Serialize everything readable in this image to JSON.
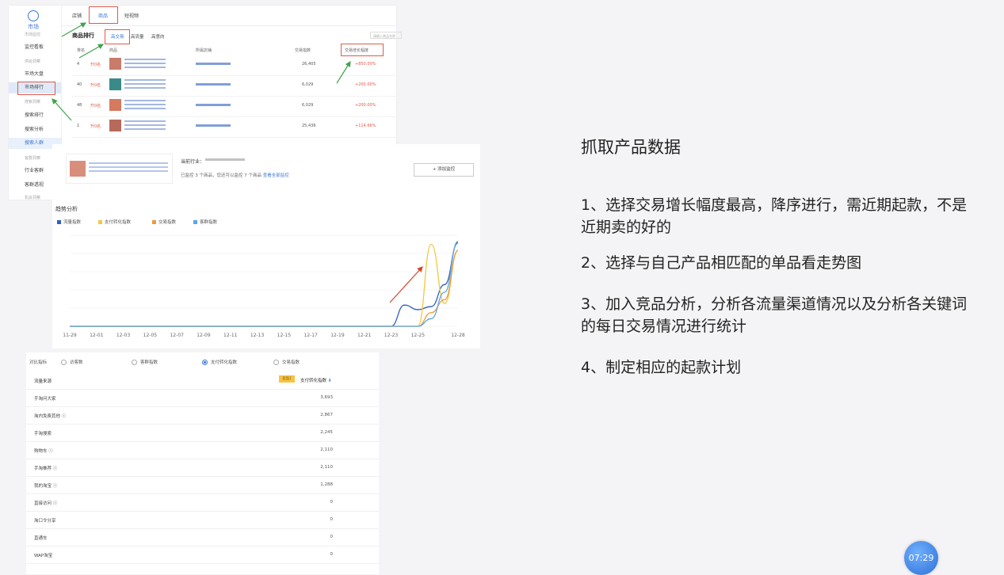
{
  "market_panel": {
    "sidebar": {
      "logo": "市场",
      "items": [
        {
          "label": "市场监控",
          "group": true
        },
        {
          "label": "监控看板"
        },
        {
          "label": "供给洞察",
          "group": true
        },
        {
          "label": "市场大盘"
        },
        {
          "label": "市场排行",
          "selected": true
        },
        {
          "label": "搜索洞察",
          "group": true
        },
        {
          "label": "搜索排行"
        },
        {
          "label": "搜索分析"
        },
        {
          "label": "搜索人群",
          "active": true
        },
        {
          "label": "客群洞察",
          "group": true
        },
        {
          "label": "行业客群"
        },
        {
          "label": "客群透视"
        },
        {
          "label": "机会洞察",
          "group": true
        }
      ]
    },
    "tabs": [
      "店铺",
      "商品",
      "短视频"
    ],
    "section_title": "商品排行",
    "subtabs": [
      "高交易",
      "高流量",
      "高意向"
    ],
    "search_placeholder": "请输入商品名称",
    "columns": [
      "排名",
      "商品",
      "所属店铺",
      "交易指数",
      "交易增长幅度"
    ],
    "rows": [
      {
        "rank": "4",
        "change": "升0名",
        "index": "26,405",
        "growth": "+850.00%"
      },
      {
        "rank": "40",
        "change": "升0名",
        "index": "6,029",
        "growth": "+200.00%"
      },
      {
        "rank": "48",
        "change": "升0名",
        "index": "6,029",
        "growth": "+200.00%"
      },
      {
        "rank": "1",
        "change": "升0名",
        "index": "25,436",
        "growth": "+114.66%"
      }
    ]
  },
  "trend_panel": {
    "industry_label": "当前行业：",
    "monitor_text": "已监控 3 个商品，您还可以监控 7 个商品",
    "monitor_link": "查看全部监控",
    "add_button": "+ 添加监控",
    "title": "趋势分析",
    "legend": [
      {
        "name": "流量指数",
        "color": "#2f5fc4"
      },
      {
        "name": "支付转化指数",
        "color": "#f2c744"
      },
      {
        "name": "交易指数",
        "color": "#ec9a3a"
      },
      {
        "name": "客群指数",
        "color": "#5aa6e8"
      }
    ],
    "chart_data": {
      "type": "line",
      "x": [
        "11-29",
        "11-30",
        "12-01",
        "12-02",
        "12-03",
        "12-04",
        "12-05",
        "12-06",
        "12-07",
        "12-08",
        "12-09",
        "12-10",
        "12-11",
        "12-12",
        "12-13",
        "12-14",
        "12-15",
        "12-16",
        "12-17",
        "12-18",
        "12-19",
        "12-20",
        "12-21",
        "12-22",
        "12-23",
        "12-24",
        "12-25",
        "12-26",
        "12-27",
        "12-28"
      ],
      "x_tick_labels": [
        "11-29",
        "12-01",
        "12-03",
        "12-05",
        "12-07",
        "12-09",
        "12-11",
        "12-13",
        "12-15",
        "12-17",
        "12-19",
        "12-21",
        "12-23",
        "12-25",
        "12-28"
      ],
      "series": [
        {
          "name": "流量指数",
          "values": [
            0,
            0,
            0,
            0,
            0,
            0,
            0,
            0,
            0,
            0,
            0,
            0,
            0,
            0,
            0,
            0,
            0,
            0,
            0,
            0,
            0,
            0,
            0,
            0,
            0,
            28,
            22,
            26,
            55,
            110
          ]
        },
        {
          "name": "支付转化指数",
          "values": [
            0,
            0,
            0,
            0,
            0,
            0,
            0,
            0,
            0,
            0,
            0,
            0,
            0,
            0,
            0,
            0,
            0,
            0,
            0,
            0,
            0,
            0,
            0,
            0,
            0,
            0,
            0,
            108,
            30,
            100
          ]
        },
        {
          "name": "交易指数",
          "values": [
            0,
            0,
            0,
            0,
            0,
            0,
            0,
            0,
            0,
            0,
            0,
            0,
            0,
            0,
            0,
            0,
            0,
            0,
            0,
            0,
            0,
            0,
            0,
            0,
            0,
            0,
            0,
            18,
            35,
            100
          ]
        },
        {
          "name": "客群指数",
          "values": [
            0,
            0,
            0,
            0,
            0,
            0,
            0,
            0,
            0,
            0,
            0,
            0,
            0,
            0,
            0,
            0,
            0,
            0,
            0,
            0,
            0,
            0,
            0,
            0,
            0,
            0,
            0,
            10,
            45,
            112
          ]
        }
      ],
      "ylim": [
        0,
        120
      ],
      "grid": true,
      "legend": "top-left"
    }
  },
  "source_panel": {
    "compare_label": "对比指标",
    "radios": [
      {
        "label": "访客数",
        "checked": false
      },
      {
        "label": "客群指数",
        "checked": false
      },
      {
        "label": "支付转化指数",
        "checked": true
      },
      {
        "label": "交易指数",
        "checked": false
      }
    ],
    "header_label": "流量来源",
    "header_badge": "竞品1",
    "header_column": "支付转化指数",
    "rows": [
      {
        "label": "手淘问大家",
        "value": "3,693"
      },
      {
        "label": "淘内免费其他",
        "value": "2,867"
      },
      {
        "label": "手淘搜索",
        "value": "2,245"
      },
      {
        "label": "购物车",
        "value": "2,110"
      },
      {
        "label": "手淘推荐",
        "value": "2,110"
      },
      {
        "label": "我的淘宝",
        "value": "1,288"
      },
      {
        "label": "直接访问",
        "value": "0"
      },
      {
        "label": "淘口令分享",
        "value": "0"
      },
      {
        "label": "直通车",
        "value": "0"
      },
      {
        "label": "WAP淘宝",
        "value": "0"
      }
    ]
  },
  "notes": {
    "title": "抓取产品数据",
    "items": [
      "1、选择交易增长幅度最高，降序进行，需近期起款，不是近期卖的好的",
      "2、选择与自己产品相匹配的单品看走势图",
      "3、加入竞品分析，分析各流量渠道情况以及分析各关键词的每日交易情况进行统计",
      "4、制定相应的起款计划"
    ]
  },
  "timer": "07:29"
}
